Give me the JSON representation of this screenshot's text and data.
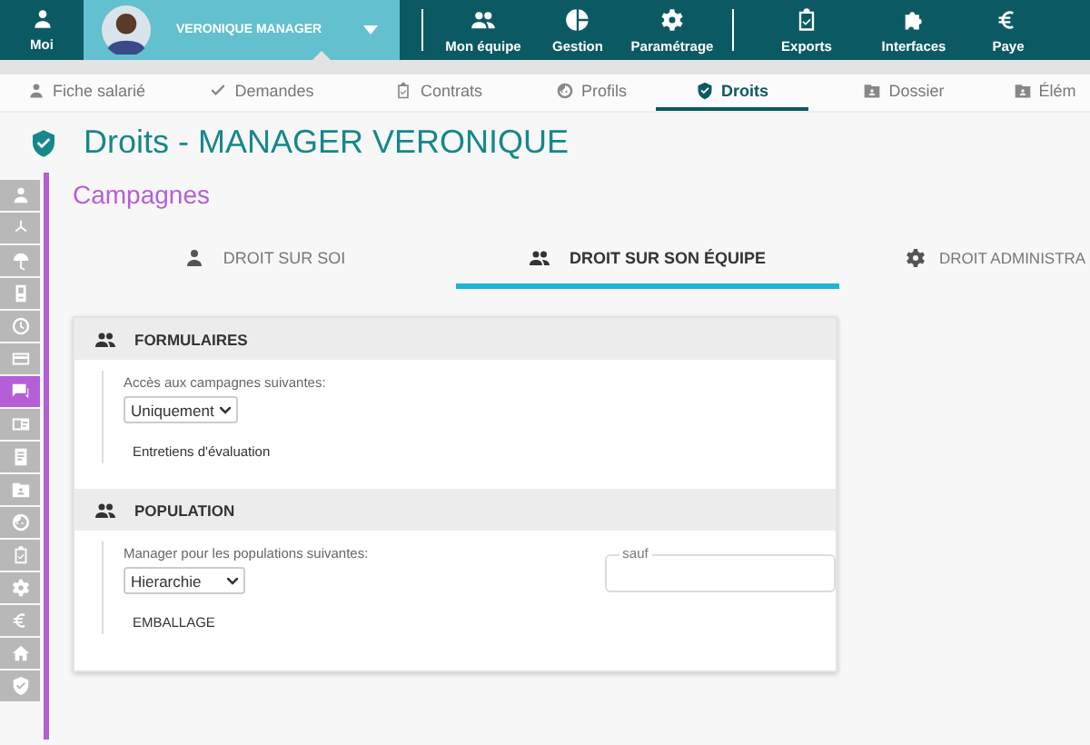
{
  "top_nav": {
    "me": {
      "label": "Moi"
    },
    "user": {
      "name": "VERONIQUE MANAGER"
    },
    "items": [
      {
        "label": "Mon équipe",
        "kind": "team"
      },
      {
        "label": "Gestion",
        "kind": "pie"
      },
      {
        "label": "Paramétrage",
        "kind": "gear"
      },
      {
        "label": "Exports",
        "kind": "clipboard"
      },
      {
        "label": "Interfaces",
        "kind": "puzzle"
      },
      {
        "label": "Paye",
        "kind": "euro"
      }
    ]
  },
  "sub_tabs": [
    {
      "label": "Fiche salarié",
      "kind": "person",
      "selected": false
    },
    {
      "label": "Demandes",
      "kind": "check",
      "selected": false
    },
    {
      "label": "Contrats",
      "kind": "clipboard",
      "selected": false
    },
    {
      "label": "Profils",
      "kind": "face",
      "selected": false
    },
    {
      "label": "Droits",
      "kind": "shield",
      "selected": true
    },
    {
      "label": "Dossier",
      "kind": "folder",
      "selected": false
    },
    {
      "label": "Élém",
      "kind": "folder",
      "selected": false
    }
  ],
  "page_title": "Droits - MANAGER VERONIQUE",
  "side_icons": [
    {
      "kind": "person",
      "selected": false
    },
    {
      "kind": "tree",
      "selected": false
    },
    {
      "kind": "umbrella",
      "selected": false
    },
    {
      "kind": "badge",
      "selected": false
    },
    {
      "kind": "clock",
      "selected": false
    },
    {
      "kind": "card",
      "selected": false
    },
    {
      "kind": "chat",
      "selected": true
    },
    {
      "kind": "idcard",
      "selected": false
    },
    {
      "kind": "doc",
      "selected": false
    },
    {
      "kind": "folder",
      "selected": false
    },
    {
      "kind": "face",
      "selected": false
    },
    {
      "kind": "clipboard",
      "selected": false
    },
    {
      "kind": "gear",
      "selected": false
    },
    {
      "kind": "euro",
      "selected": false
    },
    {
      "kind": "home",
      "selected": false
    },
    {
      "kind": "shield",
      "selected": false
    }
  ],
  "section_title": "Campagnes",
  "tabs": [
    {
      "label": "DROIT SUR SOI",
      "kind": "person",
      "selected": false
    },
    {
      "label": "DROIT SUR SON ÉQUIPE",
      "kind": "team",
      "selected": true
    },
    {
      "label": "DROIT ADMINISTRA",
      "kind": "gear",
      "selected": false
    }
  ],
  "panels": [
    {
      "title": "FORMULAIRES",
      "label": "Accès aux campagnes suivantes:",
      "select": "Uniquement",
      "items": [
        "Entretiens d'évaluation"
      ]
    },
    {
      "title": "POPULATION",
      "label": "Manager pour les populations suivantes:",
      "select": "Hierarchie",
      "except_label": "sauf",
      "items": [
        "EMBALLAGE"
      ]
    }
  ]
}
